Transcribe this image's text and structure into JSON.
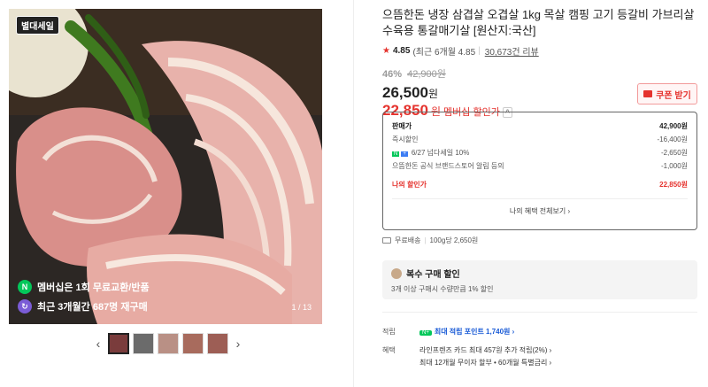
{
  "gallery": {
    "badge": "별대세일",
    "overlay_1": "멤버십은 1회 무료교환/반품",
    "overlay_2": "최근 3개월간 687명 재구매",
    "counter": "1 / 13",
    "prev_icon": "chevron-left-icon",
    "next_icon": "chevron-right-icon"
  },
  "product": {
    "title": "으뜸한돈 냉장 삼겹살 오겹살 1kg 목살 캠핑 고기 등갈비 가브리살 수육용 통갈매기살 [원산지:국산]",
    "rating": "4.85",
    "rating_recent": "(최근 6개월 4.85",
    "reviews": "30,673건 리뷰",
    "discount_pct": "46%",
    "original_price": "42,900원",
    "price": "26,500",
    "price_unit": "원",
    "member_price": "22,850",
    "member_price_unit": "원",
    "member_label": "멤버십 할인가",
    "coupon_label": "쿠폰 받기"
  },
  "breakdown": {
    "rows": [
      {
        "label": "판매가",
        "value": "42,900원"
      },
      {
        "label": "즉시할인",
        "value": "-16,400원"
      },
      {
        "label": "6/27 넘다세일 10%",
        "value": "-2,650원"
      },
      {
        "label": "으뜸한돈 공식 브랜드스토어 알림 등의",
        "value": "-1,000원"
      }
    ],
    "mine_label": "나의 할인가",
    "mine_value": "22,850원",
    "all_benefits": "나의 혜택 전체보기 ›"
  },
  "shipping": {
    "free": "무료배송",
    "unit_price": "100g당 2,650원"
  },
  "multi_buy": {
    "title": "복수 구매 할인",
    "desc": "3개 이상 구매시 수량만큼 1% 할인"
  },
  "points": {
    "label": "적립",
    "npay": "N+",
    "value": "최대 적립 포인트 1,740원 ›"
  },
  "benefits": {
    "label": "혜택",
    "line1": "라인프렌즈 카드 최대 457원 추가 적립(2%) ›",
    "line2": "최대 12개월 무이자 할부 • 60개월 특별금리 ›"
  },
  "colors": {
    "accent_red": "#e5332e",
    "naver_green": "#03c75a"
  }
}
